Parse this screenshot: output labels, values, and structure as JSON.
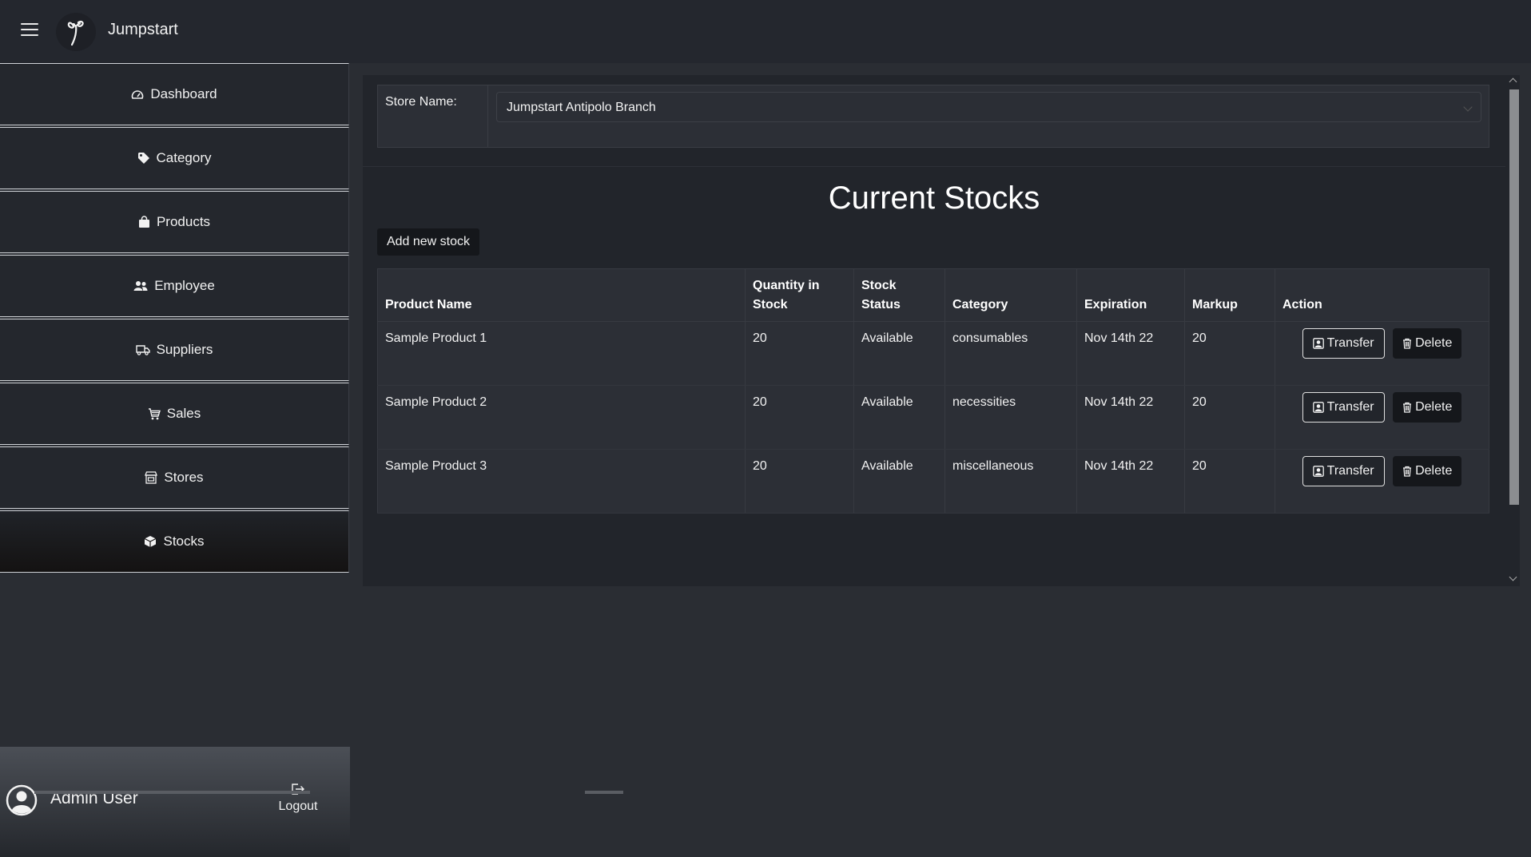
{
  "app": {
    "brand": "Jumpstart"
  },
  "sidebar": {
    "items": [
      {
        "label": "Dashboard",
        "icon": "dashboard-gauge-icon"
      },
      {
        "label": "Category",
        "icon": "tag-icon"
      },
      {
        "label": "Products",
        "icon": "shopping-bag-icon"
      },
      {
        "label": "Employee",
        "icon": "people-icon"
      },
      {
        "label": "Suppliers",
        "icon": "truck-icon"
      },
      {
        "label": "Sales",
        "icon": "cart-icon"
      },
      {
        "label": "Stores",
        "icon": "shop-icon"
      },
      {
        "label": "Stocks",
        "icon": "box-icon"
      }
    ],
    "active": "Stocks"
  },
  "user": {
    "name": "Admin User",
    "logout_label": "Logout"
  },
  "store": {
    "label": "Store Name:",
    "selected": "Jumpstart Antipolo Branch"
  },
  "page": {
    "title": "Current Stocks",
    "add_button": "Add new stock"
  },
  "table": {
    "headers": [
      "Product Name",
      "Quantity in Stock",
      "Stock Status",
      "Category",
      "Expiration",
      "Markup",
      "Action"
    ],
    "rows": [
      {
        "name": "Sample Product 1",
        "quantity": "20",
        "status": "Available",
        "category": "consumables",
        "expiration": "Nov 14th 22",
        "markup": "20"
      },
      {
        "name": "Sample Product 2",
        "quantity": "20",
        "status": "Available",
        "category": "necessities",
        "expiration": "Nov 14th 22",
        "markup": "20"
      },
      {
        "name": "Sample Product 3",
        "quantity": "20",
        "status": "Available",
        "category": "miscellaneous",
        "expiration": "Nov 14th 22",
        "markup": "20"
      }
    ],
    "transfer_label": "Transfer",
    "delete_label": "Delete"
  },
  "colors": {
    "background": "#2a2d33",
    "panel": "#22252b",
    "button_dark": "#15171b"
  }
}
